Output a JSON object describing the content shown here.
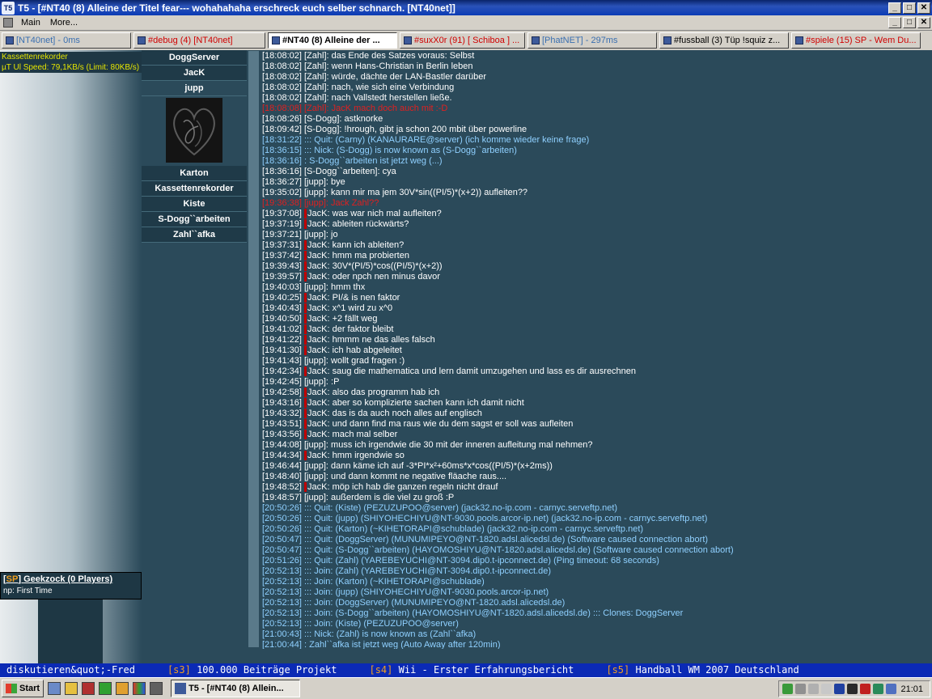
{
  "window": {
    "title": "T5 - [#NT40 (8) Alleine der Titel fear--- wohahahaha erschreck euch selber schnarch. [NT40net]]",
    "app_icon_text": "T5",
    "minimize_label": "_",
    "maximize_label": "□",
    "close_label": "✕"
  },
  "menu": {
    "items": [
      "Main",
      "More..."
    ]
  },
  "tabs": [
    {
      "label": "[NT40net] - 0ms",
      "style": "blue"
    },
    {
      "label": "#debug (4)  [NT40net]",
      "style": "red"
    },
    {
      "label": "#NT40 (8) Alleine der ...",
      "style": "active"
    },
    {
      "label": "#suxX0r (91) [ Schiboa ] ...",
      "style": "red"
    },
    {
      "label": "[PhatNET] - 297ms",
      "style": "blue"
    },
    {
      "label": "#fussball (3) Tüp !squiz z...",
      "style": "black"
    },
    {
      "label": "#spiele (15) SP - Wem Du...",
      "style": "red"
    }
  ],
  "left_panel": {
    "status_line1": "Kassettenrekorder",
    "status_line2": "µT Ul Speed: 79,1KB/s (Limit: 80KB/s)",
    "game_tag": "SP",
    "game_name": "Geekzock (0 Players)",
    "game_np": "np: First Time"
  },
  "nicklist": {
    "nicks_top": [
      "DoggServer",
      "JacK",
      "jupp"
    ],
    "nicks_bottom": [
      "Karton",
      "Kassettenrekorder",
      "Kiste",
      "S-Dogg``arbeiten",
      "Zahl``afka"
    ]
  },
  "chat": [
    {
      "ts": "[18:08:02]",
      "nick": "[Zahl]",
      "text": ": das Ende des Satzes voraus: Selbst",
      "kind": "normal"
    },
    {
      "ts": "[18:08:02]",
      "nick": "[Zahl]",
      "text": ": wenn Hans-Christian in Berlin leben",
      "kind": "normal"
    },
    {
      "ts": "[18:08:02]",
      "nick": "[Zahl]",
      "text": ": würde, dächte der LAN-Bastler darüber",
      "kind": "normal"
    },
    {
      "ts": "[18:08:02]",
      "nick": "[Zahl]",
      "text": ": nach, wie sich eine Verbindung",
      "kind": "normal"
    },
    {
      "ts": "[18:08:02]",
      "nick": "[Zahl]",
      "text": ": nach Vallstedt herstellen ließe.",
      "kind": "normal"
    },
    {
      "ts": "[18:08:08]",
      "nick": "[Zahl]",
      "text": ": JacK mach doch auch mit :-D",
      "kind": "red"
    },
    {
      "ts": "[18:08:26]",
      "nick": "[S-Dogg]",
      "text": ": astknorke",
      "kind": "normal"
    },
    {
      "ts": "[18:09:42]",
      "nick": "[S-Dogg]",
      "text": ": !hrough, gibt ja schon 200 mbit über powerline",
      "kind": "normal"
    },
    {
      "ts": "[18:31:22]",
      "nick": "::: Quit",
      "text": ": (Carny) (KANAURARE@server) (ich komme wieder keine frage)",
      "kind": "sys"
    },
    {
      "ts": "[18:36:15]",
      "nick": "::: Nick",
      "text": ": (S-Dogg) is now known as (S-Dogg``arbeiten)",
      "kind": "sys"
    },
    {
      "ts": "[18:36:16]",
      "nick": ": S-Dogg``arbeiten",
      "text": " ist jetzt weg (...)",
      "kind": "sys"
    },
    {
      "ts": "[18:36:16]",
      "nick": "[S-Dogg``arbeiten]",
      "text": ": cya",
      "kind": "normal"
    },
    {
      "ts": "[18:36:27]",
      "nick": "[jupp]",
      "text": ": bye",
      "kind": "normal"
    },
    {
      "ts": "[19:35:02]",
      "nick": "[jupp]",
      "text": ": kann mir ma jem 30V*sin((PI/5)*(x+2)) aufleiten??",
      "kind": "normal"
    },
    {
      "ts": "[19:36:38]",
      "nick": "[jupp]",
      "text": ": Jack Zahl??",
      "kind": "red"
    },
    {
      "ts": "[19:37:08]",
      "nick": "JacK",
      "text": ": was war nich mal aufleiten?",
      "kind": "jack"
    },
    {
      "ts": "[19:37:19]",
      "nick": "JacK",
      "text": ": ableiten rückwärts?",
      "kind": "jack"
    },
    {
      "ts": "[19:37:21]",
      "nick": "[jupp]",
      "text": ": jo",
      "kind": "normal"
    },
    {
      "ts": "[19:37:31]",
      "nick": "JacK",
      "text": ": kann ich ableiten?",
      "kind": "jack"
    },
    {
      "ts": "[19:37:42]",
      "nick": "JacK",
      "text": ": hmm ma probierten",
      "kind": "jack"
    },
    {
      "ts": "[19:39:43]",
      "nick": "JacK",
      "text": ": 30V*(PI/5)*cos((PI/5)*(x+2))",
      "kind": "jack"
    },
    {
      "ts": "[19:39:57]",
      "nick": "JacK",
      "text": ": oder npch nen minus davor",
      "kind": "jack"
    },
    {
      "ts": "[19:40:03]",
      "nick": "[jupp]",
      "text": ": hmm thx",
      "kind": "normal"
    },
    {
      "ts": "[19:40:25]",
      "nick": "JacK",
      "text": ": PI/& is nen faktor",
      "kind": "jack"
    },
    {
      "ts": "[19:40:43]",
      "nick": "JacK",
      "text": ": x^1 wird zu x^0",
      "kind": "jack"
    },
    {
      "ts": "[19:40:50]",
      "nick": "JacK",
      "text": ": +2 fällt weg",
      "kind": "jack"
    },
    {
      "ts": "[19:41:02]",
      "nick": "JacK",
      "text": ": der faktor bleibt",
      "kind": "jack"
    },
    {
      "ts": "[19:41:22]",
      "nick": "JacK",
      "text": ": hmmm ne das alles falsch",
      "kind": "jack"
    },
    {
      "ts": "[19:41:30]",
      "nick": "JacK",
      "text": ": ich hab abgeleitet",
      "kind": "jack"
    },
    {
      "ts": "[19:41:43]",
      "nick": "[jupp]",
      "text": ": wollt grad fragen :)",
      "kind": "normal"
    },
    {
      "ts": "[19:42:34]",
      "nick": "JacK",
      "text": ": saug die mathematica und lern damit umzugehen und lass es dir ausrechnen",
      "kind": "jack"
    },
    {
      "ts": "[19:42:45]",
      "nick": "[jupp]",
      "text": ": :P",
      "kind": "normal"
    },
    {
      "ts": "[19:42:58]",
      "nick": "JacK",
      "text": ": also das programm hab ich",
      "kind": "jack"
    },
    {
      "ts": "[19:43:16]",
      "nick": "JacK",
      "text": ": aber so komplizierte sachen kann ich damit nicht",
      "kind": "jack"
    },
    {
      "ts": "[19:43:32]",
      "nick": "JacK",
      "text": ": das is da auch noch alles auf englisch",
      "kind": "jack"
    },
    {
      "ts": "[19:43:51]",
      "nick": "JacK",
      "text": ": und dann find ma raus wie du dem sagst er soll was aufleiten",
      "kind": "jack"
    },
    {
      "ts": "[19:43:56]",
      "nick": "JacK",
      "text": ": mach mal selber",
      "kind": "jack"
    },
    {
      "ts": "[19:44:08]",
      "nick": "[jupp]",
      "text": ": muss ich irgendwie die 30 mit der inneren aufleitung mal nehmen?",
      "kind": "normal"
    },
    {
      "ts": "[19:44:34]",
      "nick": "JacK",
      "text": ": hmm irgendwie so",
      "kind": "jack"
    },
    {
      "ts": "[19:46:44]",
      "nick": "[jupp]",
      "text": ": dann käme ich auf -3*PI*x²+60ms*x*cos((PI/5)*(x+2ms))",
      "kind": "normal"
    },
    {
      "ts": "[19:48:40]",
      "nick": "[jupp]",
      "text": ": und dann kommt ne negative fläache raus....",
      "kind": "normal"
    },
    {
      "ts": "[19:48:52]",
      "nick": "JacK",
      "text": ": möp ich hab die ganzen regeln nicht drauf",
      "kind": "jack"
    },
    {
      "ts": "[19:48:57]",
      "nick": "[jupp]",
      "text": ": außerdem is die viel zu groß :P",
      "kind": "normal"
    },
    {
      "ts": "[20:50:26]",
      "nick": "::: Quit",
      "text": ": (Kiste) (PEZUZUPOO@server) (jack32.no-ip.com - carnyc.serveftp.net)",
      "kind": "sys"
    },
    {
      "ts": "[20:50:26]",
      "nick": "::: Quit",
      "text": ": (jupp) (SHIYOHECHIYU@NT-9030.pools.arcor-ip.net) (jack32.no-ip.com - carnyc.serveftp.net)",
      "kind": "sys"
    },
    {
      "ts": "[20:50:26]",
      "nick": "::: Quit",
      "text": ": (Karton) (~KIHETORAPI@schublade) (jack32.no-ip.com - carnyc.serveftp.net)",
      "kind": "sys"
    },
    {
      "ts": "[20:50:47]",
      "nick": "::: Quit",
      "text": ": (DoggServer) (MUNUMIPEYO@NT-1820.adsl.alicedsl.de) (Software caused connection abort)",
      "kind": "sys"
    },
    {
      "ts": "[20:50:47]",
      "nick": "::: Quit",
      "text": ": (S-Dogg``arbeiten) (HAYOMOSHIYU@NT-1820.adsl.alicedsl.de) (Software caused connection abort)",
      "kind": "sys"
    },
    {
      "ts": "[20:51:26]",
      "nick": "::: Quit",
      "text": ": (Zahl) (YAREBEYUCHI@NT-3094.dip0.t-ipconnect.de) (Ping timeout: 68 seconds)",
      "kind": "sys"
    },
    {
      "ts": "[20:52:13]",
      "nick": "::: Join",
      "text": ": (Zahl) (YAREBEYUCHI@NT-3094.dip0.t-ipconnect.de)",
      "kind": "sys"
    },
    {
      "ts": "[20:52:13]",
      "nick": "::: Join",
      "text": ": (Karton) (~KIHETORAPI@schublade)",
      "kind": "sys"
    },
    {
      "ts": "[20:52:13]",
      "nick": "::: Join",
      "text": ": (jupp) (SHIYOHECHIYU@NT-9030.pools.arcor-ip.net)",
      "kind": "sys"
    },
    {
      "ts": "[20:52:13]",
      "nick": "::: Join",
      "text": ": (DoggServer) (MUNUMIPEYO@NT-1820.adsl.alicedsl.de)",
      "kind": "sys"
    },
    {
      "ts": "[20:52:13]",
      "nick": "::: Join",
      "text": ": (S-Dogg``arbeiten) (HAYOMOSHIYU@NT-1820.adsl.alicedsl.de) ::: Clones: DoggServer",
      "kind": "sys"
    },
    {
      "ts": "[20:52:13]",
      "nick": "::: Join",
      "text": ": (Kiste) (PEZUZUPOO@server)",
      "kind": "sys"
    },
    {
      "ts": "[21:00:43]",
      "nick": "::: Nick",
      "text": ": (Zahl) is now known as (Zahl``afka)",
      "kind": "sys"
    },
    {
      "ts": "[21:00:44]",
      "nick": ": Zahl``afka",
      "text": " ist jetzt weg (Auto Away after 120min)",
      "kind": "sys"
    }
  ],
  "ticker": [
    {
      "tag": "",
      "text": "diskutieren&quot;-Fred"
    },
    {
      "tag": "[s3]",
      "text": " 100.000 Beiträge Projekt"
    },
    {
      "tag": "[s4]",
      "text": " Wii - Erster Erfahrungsbericht"
    },
    {
      "tag": "[s5]",
      "text": " Handball WM 2007 Deutschland"
    }
  ],
  "taskbar": {
    "start_label": "Start",
    "task_item": "T5 - [#NT40 (8) Allein...",
    "clock": "21:01"
  },
  "colors": {
    "chat_bg": "#2b4a5a",
    "system_text": "#8fd0ff",
    "highlight_text": "#e02020",
    "ticker_bg": "#0b2ab5"
  }
}
